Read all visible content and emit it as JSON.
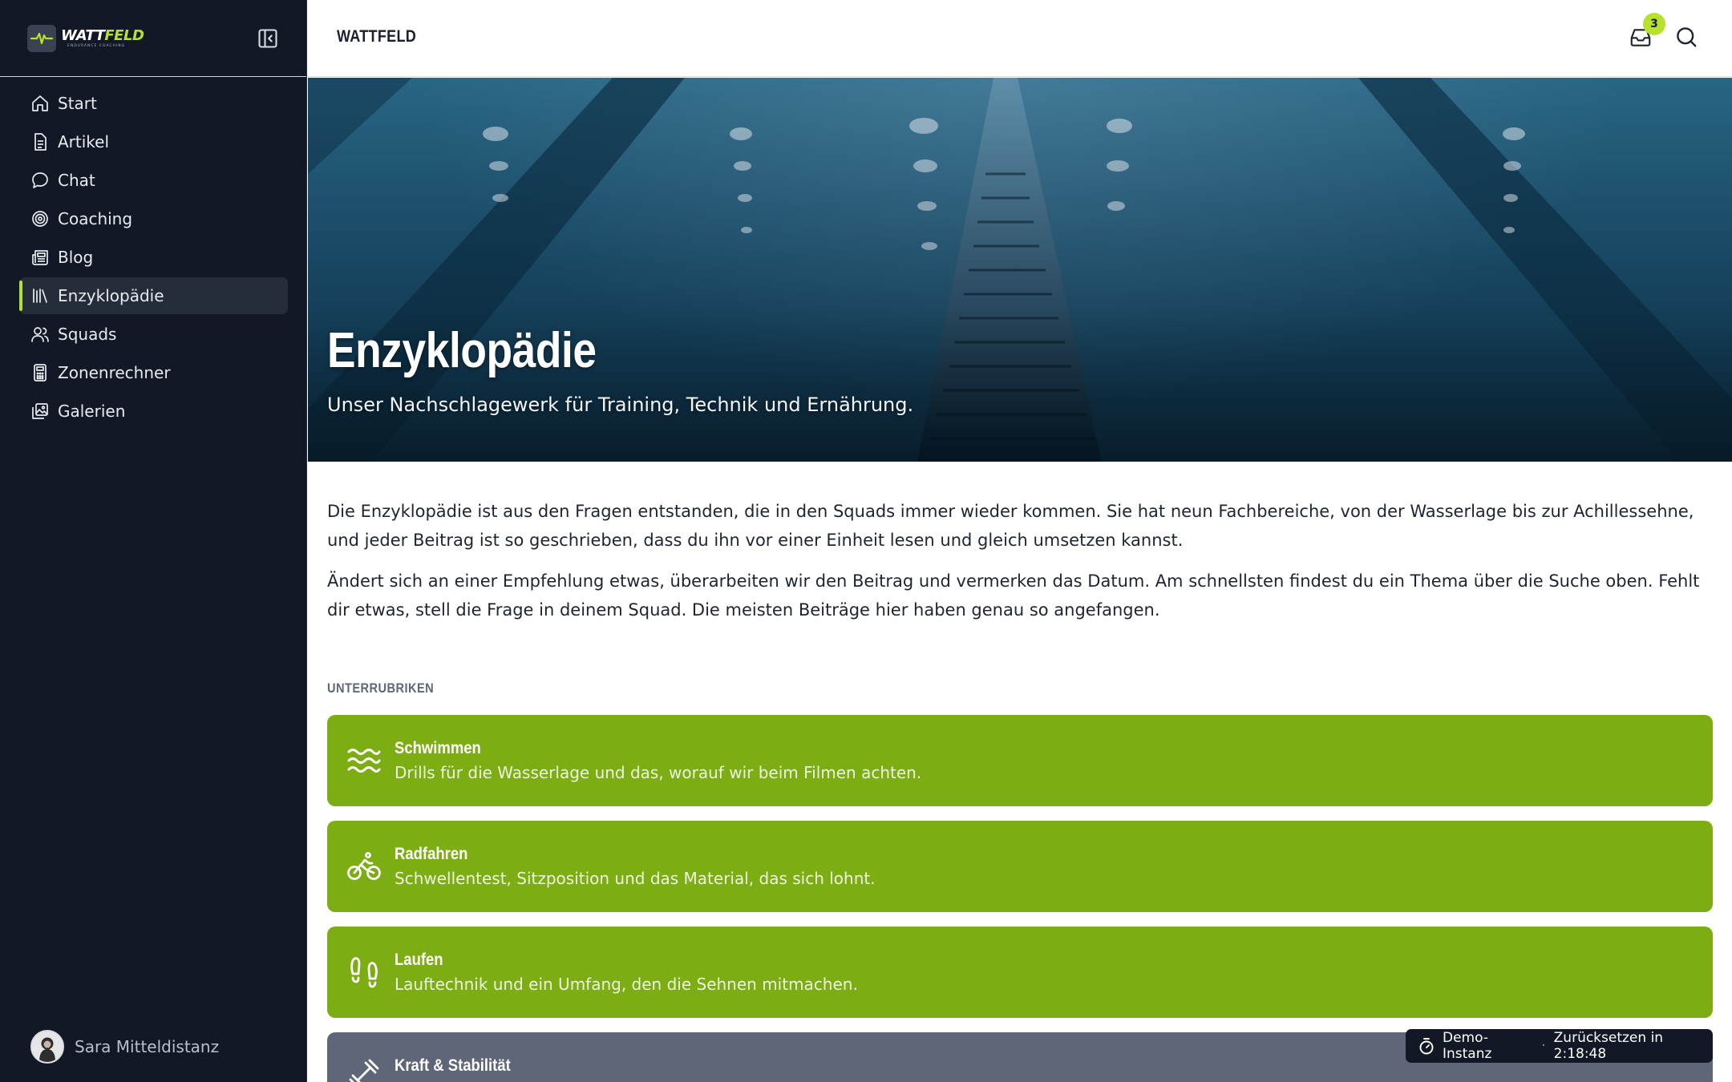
{
  "brand": {
    "logo_word_a": "WATT",
    "logo_word_b": "FELD",
    "logo_tagline": "ENDURANCE COACHING",
    "topbar_title": "WATTFELD"
  },
  "sidebar": {
    "items": [
      {
        "label": "Start",
        "icon": "home-icon"
      },
      {
        "label": "Artikel",
        "icon": "document-icon"
      },
      {
        "label": "Chat",
        "icon": "chat-bubble-icon"
      },
      {
        "label": "Coaching",
        "icon": "target-icon"
      },
      {
        "label": "Blog",
        "icon": "newspaper-icon"
      },
      {
        "label": "Enzyklopädie",
        "icon": "library-icon",
        "active": true
      },
      {
        "label": "Squads",
        "icon": "users-icon"
      },
      {
        "label": "Zonenrechner",
        "icon": "calculator-icon"
      },
      {
        "label": "Galerien",
        "icon": "gallery-icon"
      }
    ],
    "user_name": "Sara Mitteldistanz"
  },
  "topbar": {
    "inbox_count": "3"
  },
  "hero": {
    "title": "Enzyklopädie",
    "subtitle": "Unser Nachschlagewerk für Training, Technik und Ernährung."
  },
  "intro": {
    "paragraph_1": "Die Enzyklopädie ist aus den Fragen entstanden, die in den Squads immer wieder kommen. Sie hat neun Fachbereiche, von der Wasserlage bis zur Achillessehne, und jeder Beitrag ist so geschrieben, dass du ihn vor einer Einheit lesen und gleich umsetzen kannst.",
    "paragraph_2": "Ändert sich an einer Empfehlung etwas, überarbeiten wir den Beitrag und vermerken das Datum. Am schnellsten findest du ein Thema über die Suche oben. Fehlt dir etwas, stell die Frage in deinem Squad. Die meisten Beiträge hier haben genau so angefangen."
  },
  "subsections": {
    "label": "UNTERRUBRIKEN",
    "cards": [
      {
        "title": "Schwimmen",
        "description": "Drills für die Wasserlage und das, worauf wir beim Filmen achten.",
        "icon": "waves-icon"
      },
      {
        "title": "Radfahren",
        "description": "Schwellentest, Sitzposition und das Material, das sich lohnt.",
        "icon": "bike-icon"
      },
      {
        "title": "Laufen",
        "description": "Lauftechnik und ein Umfang, den die Sehnen mitmachen.",
        "icon": "footprints-icon"
      },
      {
        "title": "Kraft & Stabilität",
        "description": "",
        "icon": "dumbbell-icon"
      }
    ]
  },
  "demo_banner": {
    "label": "Demo-Instanz",
    "reset_text": "Zurücksetzen in 2:18:48"
  },
  "colors": {
    "sidebar_bg": "#121825",
    "accent_lime": "#b6e12f",
    "card_green": "#7cad13",
    "card_grey": "#5f6677"
  }
}
